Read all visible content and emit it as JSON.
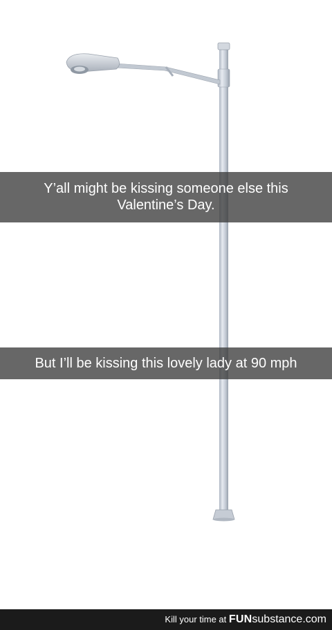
{
  "caption_top": {
    "line1": "Y’all might be kissing someone else this",
    "line2": "Valentine’s Day."
  },
  "caption_bottom": {
    "text": "But I’ll be kissing this lovely lady at 90 mph"
  },
  "footer": {
    "tagline": "Kill your time at",
    "brand_bold": "FUN",
    "brand_rest": "substance.com"
  },
  "colors": {
    "pole": "#c7ced8",
    "caption_bg": "#3c3c3c",
    "footer_bg": "#1b1b1b"
  },
  "icons": [
    "street-lamp-illustration"
  ]
}
